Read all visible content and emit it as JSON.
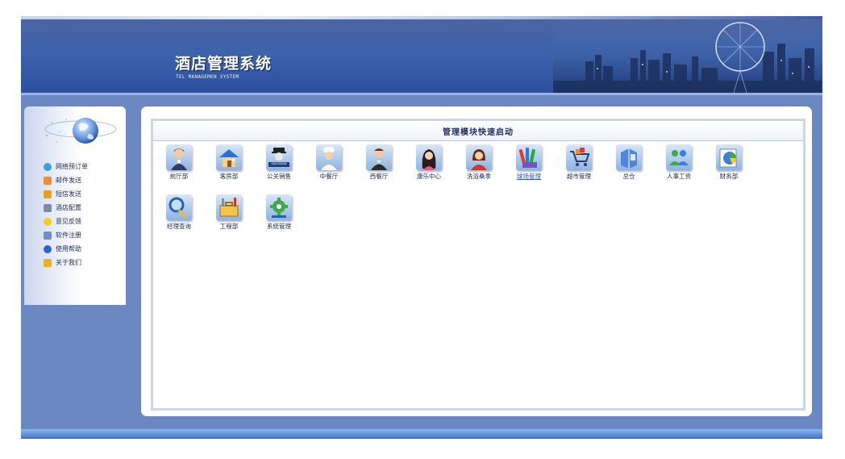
{
  "header": {
    "title": "酒店管理系统",
    "subtitle": "TEL MANAGEMEN SYSTEM"
  },
  "sidebar": {
    "items": [
      {
        "label": "网络预订单",
        "icon": "globe-icon",
        "color": "#3aa0d8"
      },
      {
        "label": "邮件发送",
        "icon": "mail-icon",
        "color": "#f08c2e"
      },
      {
        "label": "短信发送",
        "icon": "sms-check-icon",
        "color": "#e6a21e"
      },
      {
        "label": "酒店配置",
        "icon": "wrench-icon",
        "color": "#7a8ca6"
      },
      {
        "label": "意见反馈",
        "icon": "lightbulb-icon",
        "color": "#f3cf20"
      },
      {
        "label": "软件注册",
        "icon": "document-icon",
        "color": "#6f8fc8"
      },
      {
        "label": "使用帮助",
        "icon": "help-icon",
        "color": "#2f63c4"
      },
      {
        "label": "关于我们",
        "icon": "star-icon",
        "color": "#e7b21c"
      }
    ]
  },
  "panel": {
    "title": "管理模块快速启动",
    "modules": [
      {
        "label": "前厅部",
        "icon": "receptionist-icon"
      },
      {
        "label": "客房部",
        "icon": "house-icon"
      },
      {
        "label": "公关销售",
        "icon": "salesman-icon",
        "badge": "SALESMAN"
      },
      {
        "label": "中餐厅",
        "icon": "chef-icon"
      },
      {
        "label": "西餐厅",
        "icon": "waiter-icon"
      },
      {
        "label": "康乐中心",
        "icon": "woman-icon"
      },
      {
        "label": "洗浴桑拿",
        "icon": "spa-woman-icon"
      },
      {
        "label": "球场管理",
        "icon": "pencils-icon",
        "selected": true
      },
      {
        "label": "超市管理",
        "icon": "shopping-cart-icon"
      },
      {
        "label": "总仓",
        "icon": "warehouse-icon"
      },
      {
        "label": "人事工资",
        "icon": "people-icon"
      },
      {
        "label": "财务部",
        "icon": "pie-chart-icon"
      },
      {
        "label": "经理查询",
        "icon": "magnifier-icon"
      },
      {
        "label": "工程部",
        "icon": "toolbox-icon"
      },
      {
        "label": "系统管理",
        "icon": "system-gear-icon"
      }
    ]
  }
}
